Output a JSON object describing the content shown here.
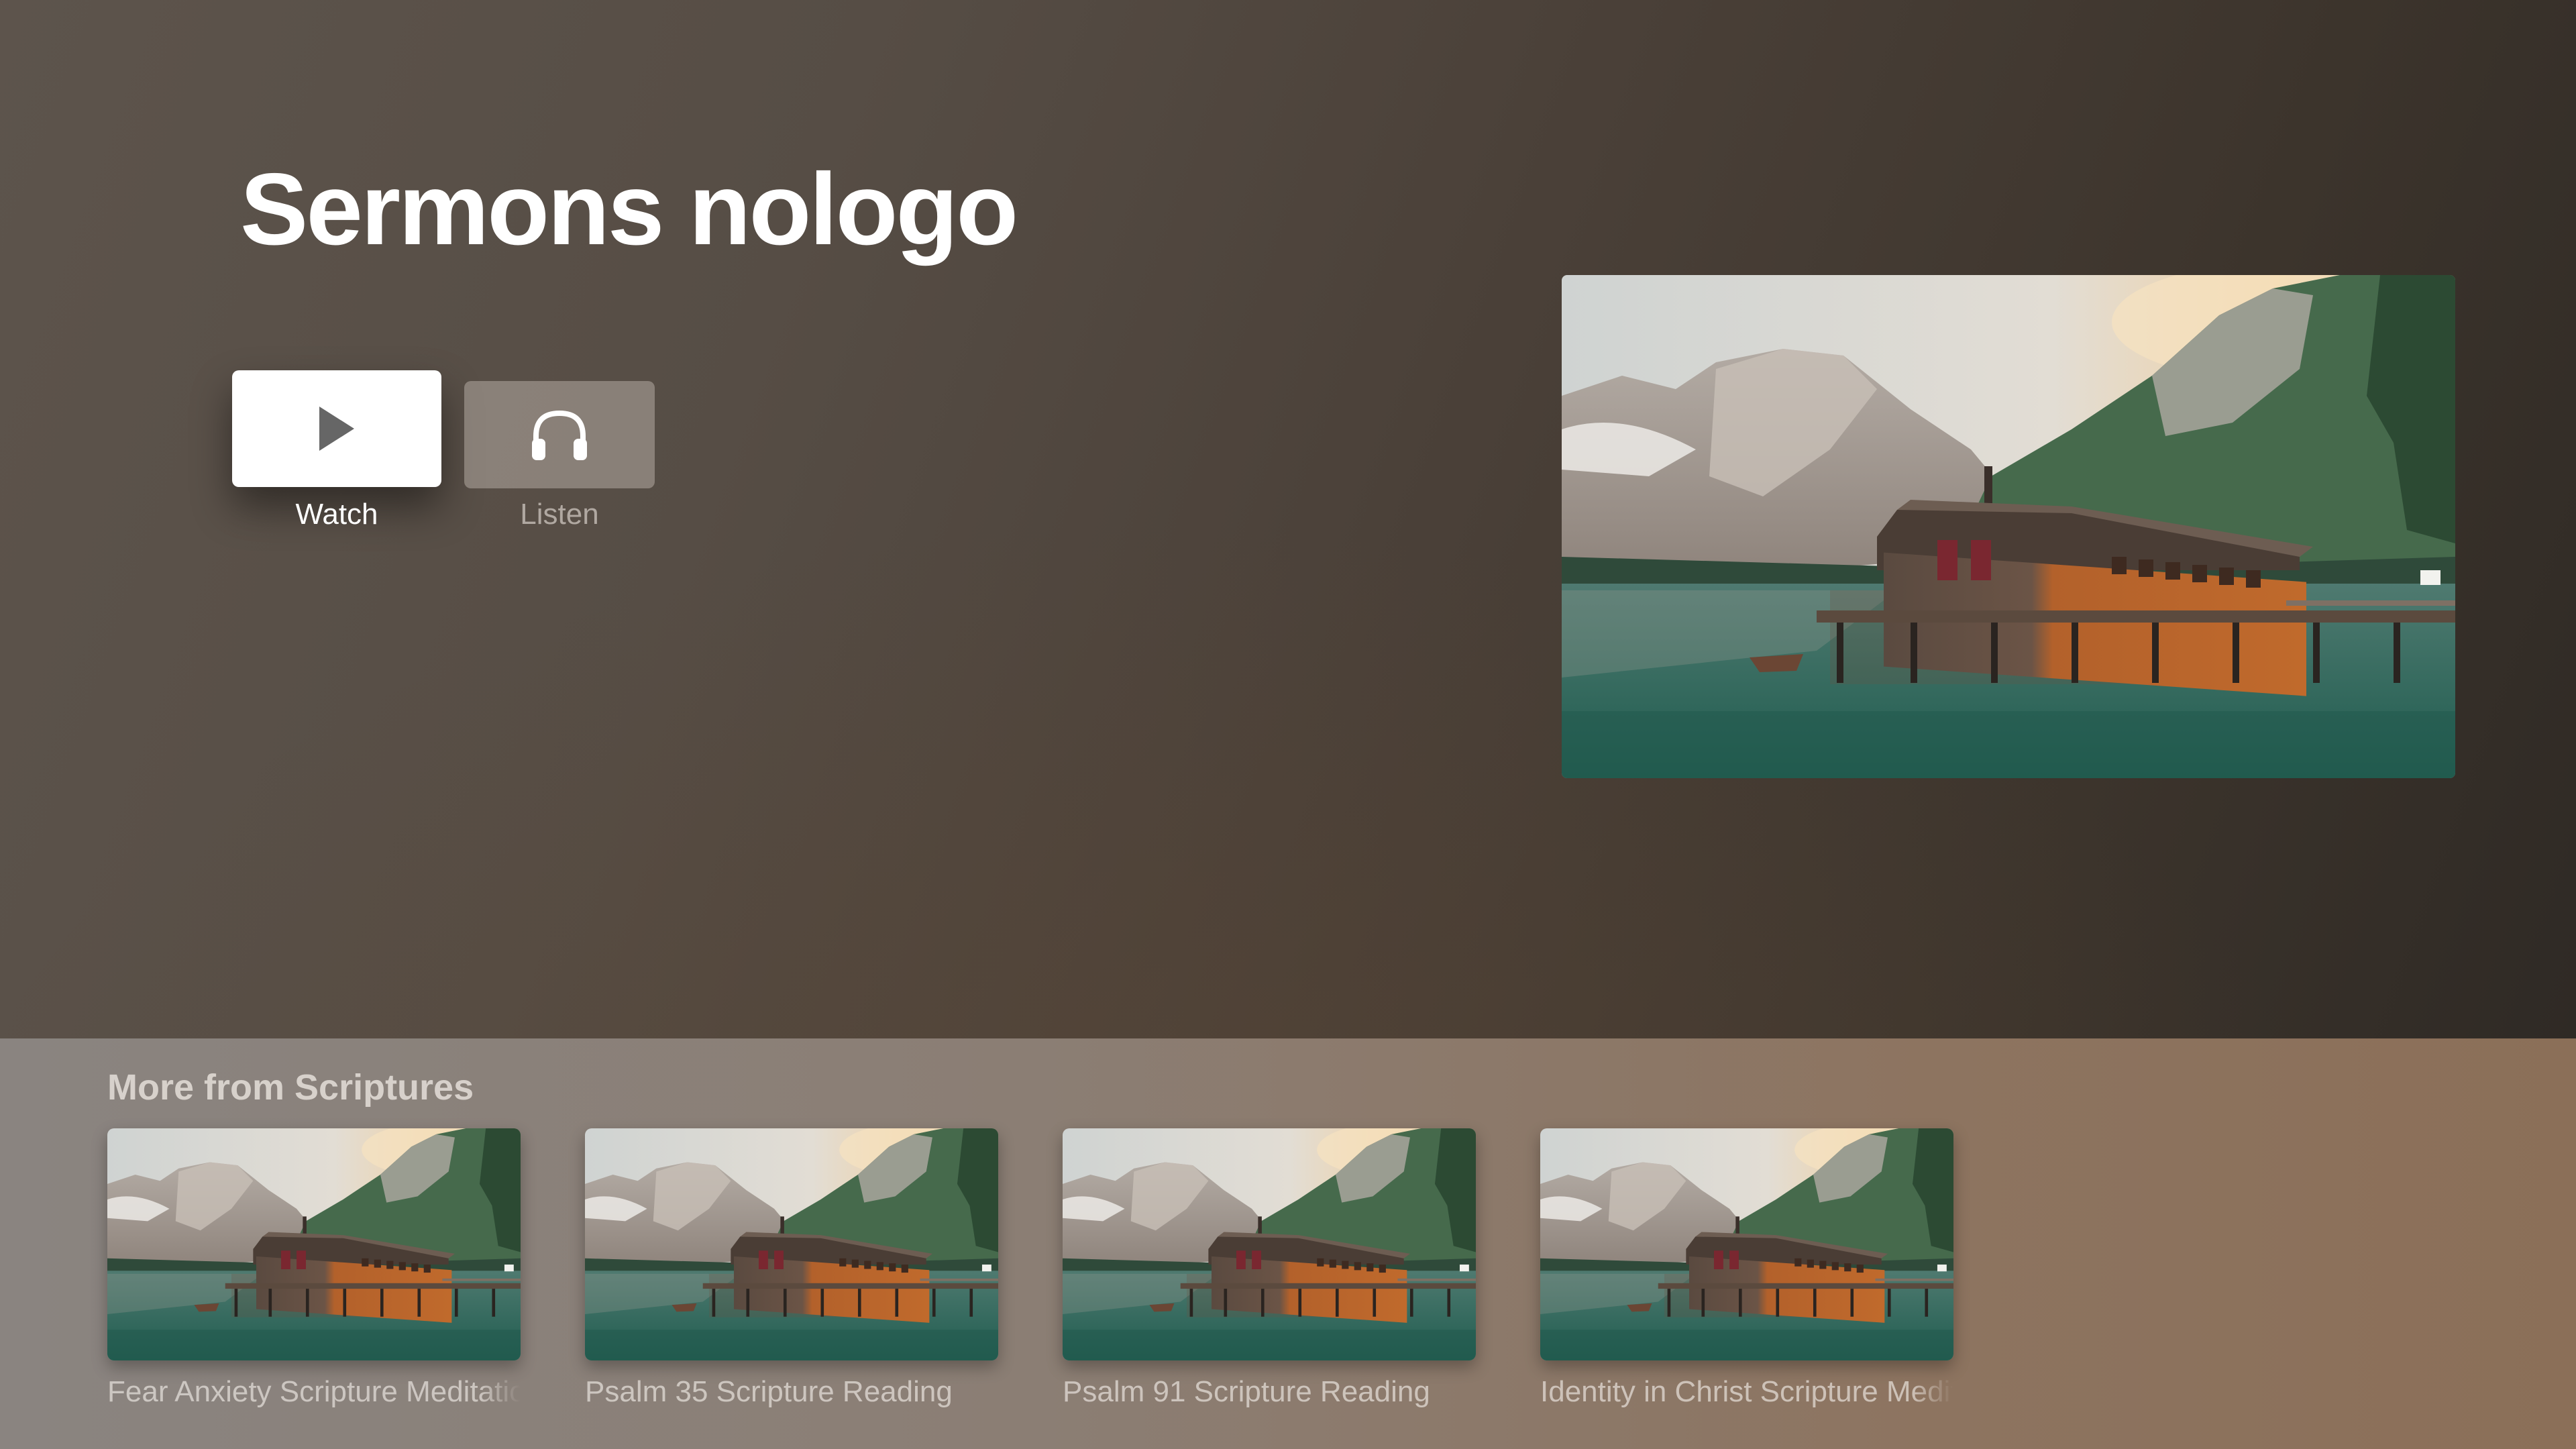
{
  "page": {
    "title": "Sermons nologo"
  },
  "actions": {
    "watch_label": "Watch",
    "watch_icon": "play-icon",
    "listen_label": "Listen",
    "listen_icon": "headphones-icon",
    "focused": "watch"
  },
  "hero": {
    "image": "lake-boathouse-mountains"
  },
  "shelf": {
    "title": "More from Scriptures",
    "items": [
      {
        "title": "Fear Anxiety Scripture Meditation",
        "image": "lake-boathouse-mountains"
      },
      {
        "title": "Psalm 35 Scripture Reading",
        "image": "lake-boathouse-mountains"
      },
      {
        "title": "Psalm 91 Scripture Reading",
        "image": "lake-boathouse-mountains"
      },
      {
        "title": "Identity in Christ Scripture Meditation",
        "image": "lake-boathouse-mountains"
      }
    ]
  },
  "colors": {
    "hero_background": "#4a4038",
    "shelf_background": "#8b7e74",
    "focused_button": "#ffffff"
  }
}
